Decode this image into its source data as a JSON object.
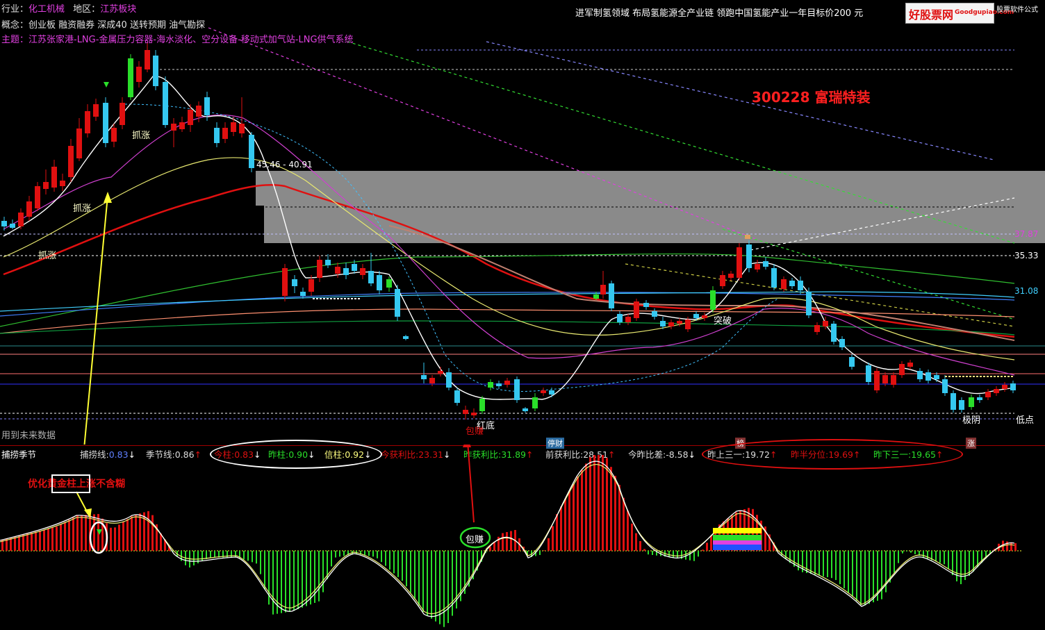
{
  "header": {
    "industry_label": "行业：",
    "industry": "化工机械",
    "region_label": "地区：",
    "region": "江苏板块",
    "concept": "概念：创业板 融资融券 深成40 送转预期 油气勘探",
    "theme": "主题：江苏张家港-LNG-金属压力容器-海水淡化、空分设备-移动式加气站-LNG供气系统",
    "news": "进军制氢领域 布局氢能源全产业链 领跑中国氢能产业一年目标价200 元",
    "logo_main": "好股票网",
    "logo_domain": "Goodgupiao.com",
    "logo_tag": "股票软件公式",
    "stock_title": "300228 富瑞特装"
  },
  "colors": {
    "up": "#e01010",
    "down": "#35c8f0",
    "accent_green": "#2adf2a",
    "accent_yellow": "#ffff33",
    "label_magenta": "#e040e0"
  },
  "main_chart": {
    "price_labels": [
      "37.87",
      "35.33",
      "31.08"
    ],
    "range_label": "45.46 - 40.91",
    "annotations": {
      "zhuazhang1": "抓涨",
      "zhuazhang2": "抓涨",
      "zhuazhang3": "抓涨",
      "hongdi": "红底",
      "baozhuan": "包赚",
      "tupo": "突破",
      "jiyin": "极阴",
      "didian": "低点",
      "future": "用到未来数据"
    }
  },
  "indicator_bar": {
    "name": "捕捞季节",
    "items": [
      {
        "label": "捕捞线:",
        "value": "0.83",
        "arrow": "↓"
      },
      {
        "label": "季节线:",
        "value": "0.86",
        "arrow": "↑"
      },
      {
        "label": "今柱:",
        "value": "0.83",
        "arrow": "↓"
      },
      {
        "label": "昨柱:",
        "value": "0.90",
        "arrow": "↓"
      },
      {
        "label": "信柱:",
        "value": "0.92",
        "arrow": "↓"
      },
      {
        "label": "今获利比:",
        "value": "23.31",
        "arrow": "↓"
      },
      {
        "label": "昨获利比:",
        "value": "31.89",
        "arrow": "↑"
      },
      {
        "label": "前获利比:",
        "value": "28.51",
        "arrow": "↑"
      },
      {
        "label": "今昨比差:",
        "value": "-8.58",
        "arrow": "↓"
      },
      {
        "label": "昨上三一:",
        "value": "19.72",
        "arrow": "↑"
      },
      {
        "label": "昨半分位:",
        "value": "19.69",
        "arrow": "↑"
      },
      {
        "label": "昨下三一:",
        "value": "19.65",
        "arrow": "↑"
      }
    ],
    "tags": {
      "tingcai": "停财",
      "zhang": "涨",
      "shang": "榜"
    }
  },
  "sub_chart": {
    "note": "优化黄金柱上涨不含糊",
    "note_highlight": "黄金柱",
    "baozhuan": "包赚"
  }
}
